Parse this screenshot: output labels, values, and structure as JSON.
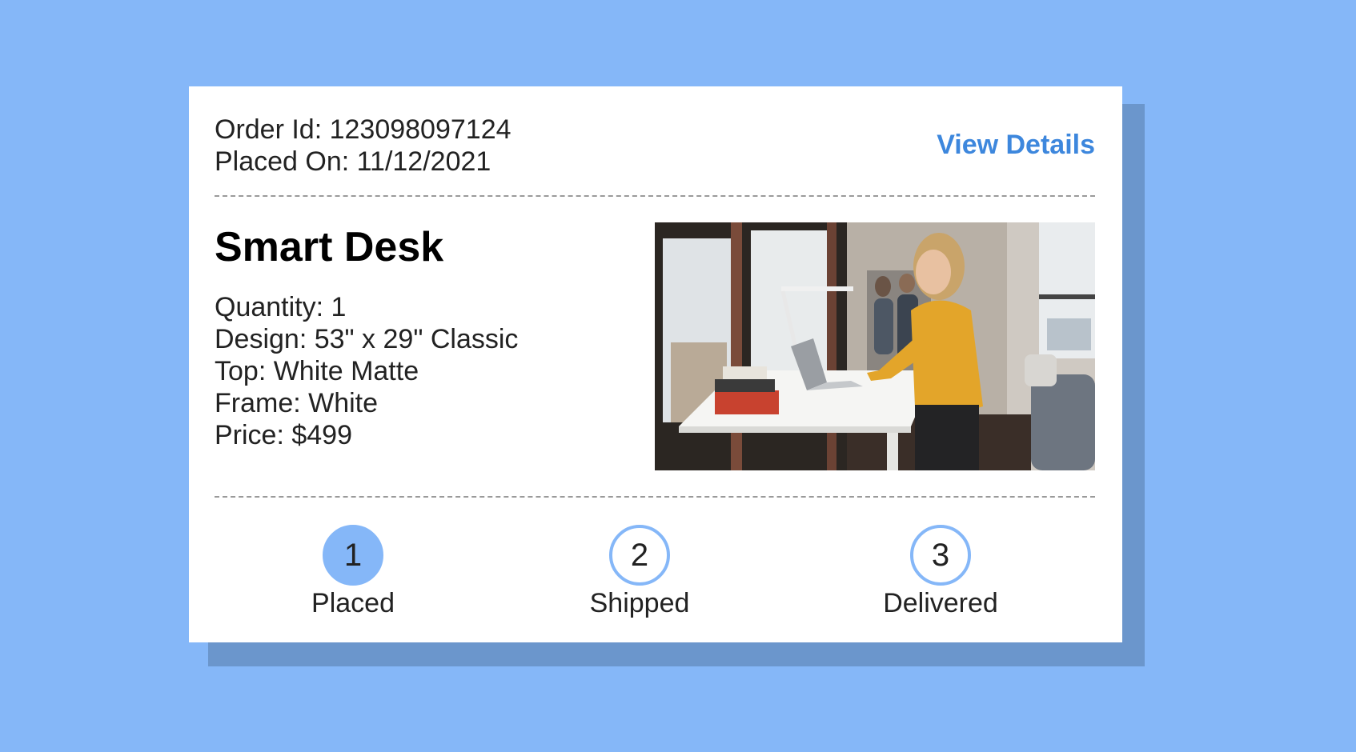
{
  "order": {
    "id_line": "Order Id: 123098097124",
    "placed_line": "Placed On: 11/12/2021",
    "view_details_label": "View Details"
  },
  "product": {
    "name": "Smart Desk",
    "quantity": "Quantity: 1",
    "design": "Design: 53\" x 29\" Classic",
    "top": "Top: White Matte",
    "frame": "Frame: White",
    "price": "Price: $499",
    "photo_icon": "product-photo"
  },
  "steps": [
    {
      "number": "1",
      "label": "Placed",
      "active": true
    },
    {
      "number": "2",
      "label": "Shipped",
      "active": false
    },
    {
      "number": "3",
      "label": "Delivered",
      "active": false
    }
  ],
  "colors": {
    "background": "#85b7f8",
    "shadow": "#6b96cc",
    "link": "#3d87dd",
    "step_active": "#85b7f8"
  }
}
